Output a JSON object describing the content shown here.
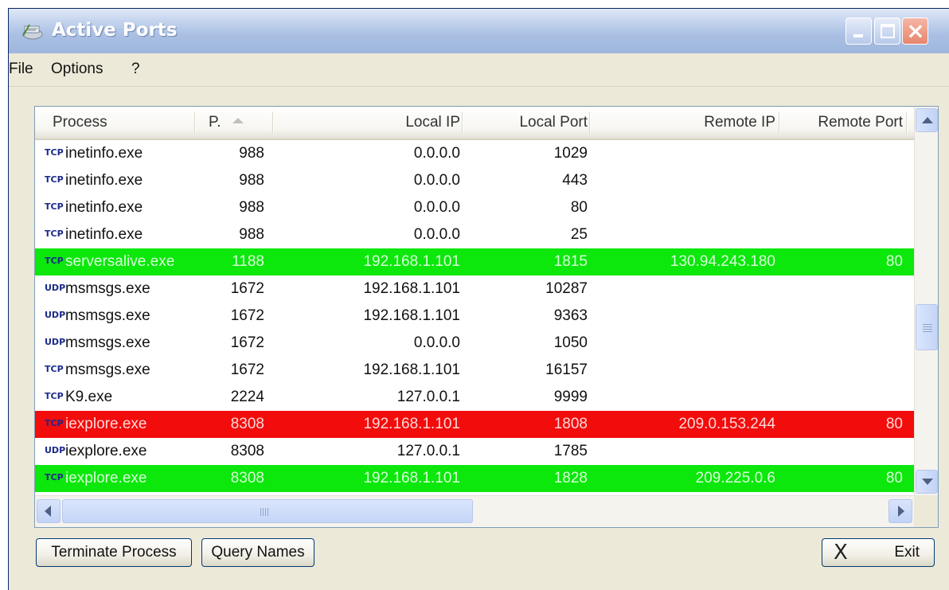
{
  "window": {
    "title": "Active Ports",
    "close_glyph": "×"
  },
  "menu": [
    "File",
    "Options",
    "?"
  ],
  "columns": [
    "Process",
    "P.",
    "Local IP",
    "Local Port",
    "Remote IP",
    "Remote Port"
  ],
  "sort": {
    "column": "P.",
    "direction": "ascending"
  },
  "colors": {
    "highlight_green": "#0ce70c",
    "highlight_red": "#f20c0c"
  },
  "rows": [
    {
      "proto": "TCP",
      "process": "inetinfo.exe",
      "pid": "988",
      "local_ip": "0.0.0.0",
      "local_port": "1029",
      "remote_ip": "",
      "remote_port": "",
      "status": "normal"
    },
    {
      "proto": "TCP",
      "process": "inetinfo.exe",
      "pid": "988",
      "local_ip": "0.0.0.0",
      "local_port": "443",
      "remote_ip": "",
      "remote_port": "",
      "status": "normal"
    },
    {
      "proto": "TCP",
      "process": "inetinfo.exe",
      "pid": "988",
      "local_ip": "0.0.0.0",
      "local_port": "80",
      "remote_ip": "",
      "remote_port": "",
      "status": "normal"
    },
    {
      "proto": "TCP",
      "process": "inetinfo.exe",
      "pid": "988",
      "local_ip": "0.0.0.0",
      "local_port": "25",
      "remote_ip": "",
      "remote_port": "",
      "status": "normal"
    },
    {
      "proto": "TCP",
      "process": "serversalive.exe",
      "pid": "1188",
      "local_ip": "192.168.1.101",
      "local_port": "1815",
      "remote_ip": "130.94.243.180",
      "remote_port": "80",
      "status": "green"
    },
    {
      "proto": "UDP",
      "process": "msmsgs.exe",
      "pid": "1672",
      "local_ip": "192.168.1.101",
      "local_port": "10287",
      "remote_ip": "",
      "remote_port": "",
      "status": "normal"
    },
    {
      "proto": "UDP",
      "process": "msmsgs.exe",
      "pid": "1672",
      "local_ip": "192.168.1.101",
      "local_port": "9363",
      "remote_ip": "",
      "remote_port": "",
      "status": "normal"
    },
    {
      "proto": "UDP",
      "process": "msmsgs.exe",
      "pid": "1672",
      "local_ip": "0.0.0.0",
      "local_port": "1050",
      "remote_ip": "",
      "remote_port": "",
      "status": "normal"
    },
    {
      "proto": "TCP",
      "process": "msmsgs.exe",
      "pid": "1672",
      "local_ip": "192.168.1.101",
      "local_port": "16157",
      "remote_ip": "",
      "remote_port": "",
      "status": "normal"
    },
    {
      "proto": "TCP",
      "process": "K9.exe",
      "pid": "2224",
      "local_ip": "127.0.0.1",
      "local_port": "9999",
      "remote_ip": "",
      "remote_port": "",
      "status": "normal"
    },
    {
      "proto": "TCP",
      "process": "iexplore.exe",
      "pid": "8308",
      "local_ip": "192.168.1.101",
      "local_port": "1808",
      "remote_ip": "209.0.153.244",
      "remote_port": "80",
      "status": "red"
    },
    {
      "proto": "UDP",
      "process": "iexplore.exe",
      "pid": "8308",
      "local_ip": "127.0.0.1",
      "local_port": "1785",
      "remote_ip": "",
      "remote_port": "",
      "status": "normal"
    },
    {
      "proto": "TCP",
      "process": "iexplore.exe",
      "pid": "8308",
      "local_ip": "192.168.1.101",
      "local_port": "1828",
      "remote_ip": "209.225.0.6",
      "remote_port": "80",
      "status": "green"
    }
  ],
  "buttons": {
    "terminate": "Terminate Process",
    "query": "Query Names",
    "exit": "Exit",
    "exit_icon": "X"
  },
  "icons": {
    "app": "ports-icon",
    "minimize": "minimize-icon",
    "maximize": "maximize-icon",
    "close": "close-icon"
  }
}
